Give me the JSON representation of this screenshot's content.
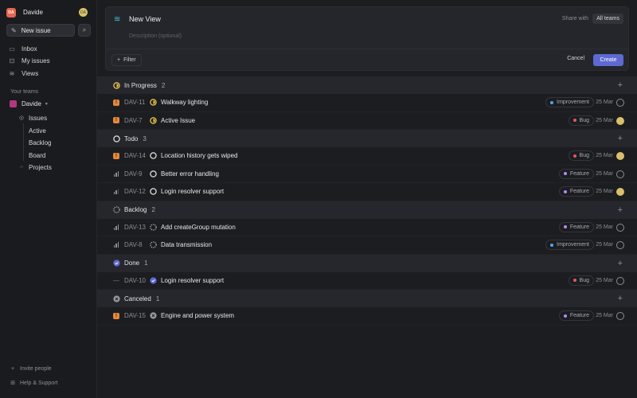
{
  "sidebar": {
    "workspace": {
      "initials": "DA",
      "name": "Davide",
      "avatar": "DA"
    },
    "new_issue_label": "New issue",
    "nav": [
      {
        "label": "Inbox",
        "icon": "inbox-icon"
      },
      {
        "label": "My issues",
        "icon": "my-issues-icon"
      },
      {
        "label": "Views",
        "icon": "layers-icon"
      }
    ],
    "teams_label": "Your teams",
    "team_name": "Davide",
    "issues_label": "Issues",
    "issue_sub": [
      "Active",
      "Backlog",
      "Board"
    ],
    "projects_label": "Projects",
    "invite_label": "Invite people",
    "help_label": "Help & Support"
  },
  "view": {
    "title": "New View",
    "description_placeholder": "Description (optional)",
    "share_label": "Share with",
    "share_value": "All teams",
    "filter_label": "Filter",
    "cancel_label": "Cancel",
    "create_label": "Create"
  },
  "colors": {
    "accent": "#5e6ad2",
    "in_progress": "#f2c94c",
    "feature": "#bb87fc",
    "improvement": "#4ea7fc",
    "bug": "#eb5757",
    "urgent": "#e7873c"
  },
  "groups": [
    {
      "name": "In Progress",
      "count": "2",
      "state": "in_progress",
      "issues": [
        {
          "priority": "urgent",
          "id": "DAV-11",
          "title": "Walkway lighting",
          "label": "Improvement",
          "label_color": "#4ea7fc",
          "date": "25 Mar",
          "assignee": "empty"
        },
        {
          "priority": "urgent",
          "id": "DAV-7",
          "title": "Active Issue",
          "label": "Bug",
          "label_color": "#eb5757",
          "date": "25 Mar",
          "assignee": "user"
        }
      ]
    },
    {
      "name": "Todo",
      "count": "3",
      "state": "todo",
      "issues": [
        {
          "priority": "urgent",
          "id": "DAV-14",
          "title": "Location history gets wiped",
          "label": "Bug",
          "label_color": "#eb5757",
          "date": "25 Mar",
          "assignee": "user"
        },
        {
          "priority": "high",
          "id": "DAV-9",
          "title": "Better error handling",
          "label": "Feature",
          "label_color": "#bb87fc",
          "date": "25 Mar",
          "assignee": "empty"
        },
        {
          "priority": "medium",
          "id": "DAV-12",
          "title": "Login resolver support",
          "label": "Feature",
          "label_color": "#bb87fc",
          "date": "25 Mar",
          "assignee": "user"
        }
      ]
    },
    {
      "name": "Backlog",
      "count": "2",
      "state": "backlog",
      "issues": [
        {
          "priority": "high",
          "id": "DAV-13",
          "title": "Add createGroup mutation",
          "label": "Feature",
          "label_color": "#bb87fc",
          "date": "25 Mar",
          "assignee": "empty"
        },
        {
          "priority": "high",
          "id": "DAV-8",
          "title": "Data transmission",
          "label": "Improvement",
          "label_color": "#4ea7fc",
          "date": "25 Mar",
          "assignee": "empty"
        }
      ]
    },
    {
      "name": "Done",
      "count": "1",
      "state": "done",
      "issues": [
        {
          "priority": "none",
          "id": "DAV-10",
          "title": "Login resolver support",
          "label": "Bug",
          "label_color": "#eb5757",
          "date": "25 Mar",
          "assignee": "empty"
        }
      ]
    },
    {
      "name": "Canceled",
      "count": "1",
      "state": "canceled",
      "issues": [
        {
          "priority": "urgent",
          "id": "DAV-15",
          "title": "Engine and power system",
          "label": "Feature",
          "label_color": "#bb87fc",
          "date": "25 Mar",
          "assignee": "empty"
        }
      ]
    }
  ]
}
